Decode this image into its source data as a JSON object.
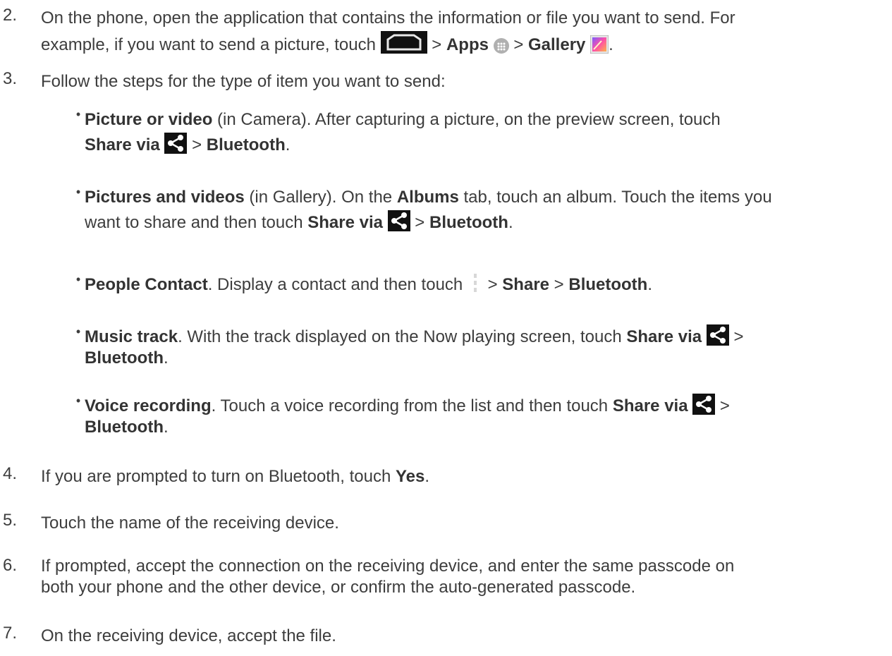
{
  "steps": [
    {
      "num": "2.",
      "text1": "On the phone, open the application that contains the information or file you want to send. For",
      "text2": "example, if you want to send a picture, touch",
      "sep1": ">",
      "apps": "Apps",
      "sep2": ">",
      "gallery": "Gallery",
      "end": "."
    },
    {
      "num": "3.",
      "text": "Follow the steps for the type of item you want to send:"
    },
    {
      "num": "4.",
      "text": "If you are prompted to turn on Bluetooth, touch",
      "bold": "Yes",
      "end": "."
    },
    {
      "num": "5.",
      "text": "Touch the name of the receiving device."
    },
    {
      "num": "6.",
      "text1": "If prompted, accept the connection on the receiving device, and enter the same passcode on",
      "text2": "both your phone and the other device, or confirm the auto-generated passcode."
    },
    {
      "num": "7.",
      "text": "On the receiving device, accept the file."
    }
  ],
  "bullets": [
    {
      "dot": "•",
      "title": "Picture or video",
      "t1": " (in Camera). After capturing a picture, on the preview screen, touch",
      "share": "Share via",
      "sep": ">",
      "bt": "Bluetooth",
      "end": "."
    },
    {
      "dot": "•",
      "title": "Pictures and videos",
      "t1": " (in Gallery). On the ",
      "albums": "Albums",
      "t2": " tab, touch an album. Touch the items you",
      "t3": "want to share and then touch ",
      "share": "Share via",
      "sep": ">",
      "bt": "Bluetooth",
      "end": "."
    },
    {
      "dot": "•",
      "title": "People Contact",
      "t1": ". Display a contact and then touch",
      "sep1": ">",
      "share": "Share",
      "sep2": ">",
      "bt": "Bluetooth",
      "end": "."
    },
    {
      "dot": "•",
      "title": "Music track",
      "t1": ". With the track displayed on the Now playing screen, touch ",
      "share": "Share via",
      "sep": ">",
      "bt": "Bluetooth",
      "end": "."
    },
    {
      "dot": "•",
      "title": "Voice recording",
      "t1": ". Touch a voice recording from the list and then touch ",
      "share": "Share via",
      "sep": ">",
      "bt": "Bluetooth",
      "end": "."
    }
  ],
  "icons": {
    "home": "home-icon",
    "apps": "apps-icon",
    "gallery": "gallery-icon",
    "share": "share-icon",
    "menu": "menu-icon"
  },
  "colors": {
    "text": "#3d3d3d",
    "icon_dark": "#111111",
    "apps_icon": "#b0b0b0"
  }
}
